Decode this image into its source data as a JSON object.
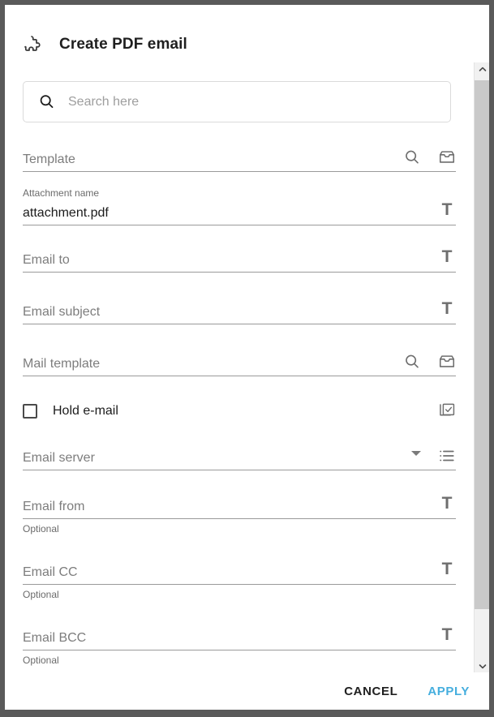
{
  "dialog": {
    "title": "Create PDF email",
    "icon": "puzzle-piece-icon"
  },
  "search": {
    "placeholder": "Search here",
    "value": "",
    "icon": "search-icon"
  },
  "fields": [
    {
      "name": "template",
      "label": "Template",
      "sublabel": "",
      "value": "",
      "helper": "",
      "actions": [
        "search-icon",
        "inbox-tray-icon"
      ]
    },
    {
      "name": "attachment-name",
      "label": "",
      "sublabel": "Attachment name",
      "value": "attachment.pdf",
      "helper": "",
      "actions": [
        "text-t-icon"
      ]
    },
    {
      "name": "email-to",
      "label": "Email to",
      "sublabel": "",
      "value": "",
      "helper": "",
      "actions": [
        "text-t-icon"
      ]
    },
    {
      "name": "email-subject",
      "label": "Email subject",
      "sublabel": "",
      "value": "",
      "helper": "",
      "actions": [
        "text-t-icon"
      ]
    },
    {
      "name": "mail-template",
      "label": "Mail template",
      "sublabel": "",
      "value": "",
      "helper": "",
      "actions": [
        "search-icon",
        "inbox-tray-icon"
      ]
    }
  ],
  "hold_email": {
    "label": "Hold e-mail",
    "checked": false,
    "action_icon": "checkbox-copy-icon"
  },
  "email_server": {
    "label": "Email server",
    "value": "",
    "actions": [
      "chevron-down-icon",
      "list-icon"
    ]
  },
  "optional_fields": [
    {
      "name": "email-from",
      "label": "Email from",
      "value": "",
      "helper": "Optional",
      "actions": [
        "text-t-icon"
      ]
    },
    {
      "name": "email-cc",
      "label": "Email CC",
      "value": "",
      "helper": "Optional",
      "actions": [
        "text-t-icon"
      ]
    },
    {
      "name": "email-bcc",
      "label": "Email BCC",
      "value": "",
      "helper": "Optional",
      "actions": [
        "text-t-icon"
      ]
    }
  ],
  "footer": {
    "cancel_label": "CANCEL",
    "apply_label": "APPLY",
    "apply_color": "#45aede"
  },
  "scrollbar": {
    "up_icon": "chevron-up-icon",
    "down_icon": "chevron-down-icon"
  }
}
